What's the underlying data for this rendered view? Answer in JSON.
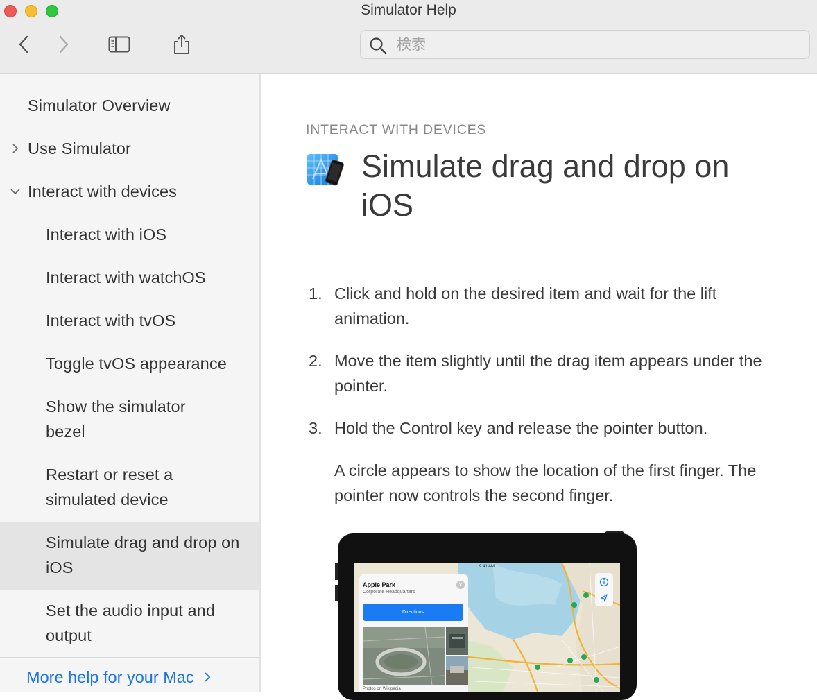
{
  "window": {
    "title": "Simulator Help"
  },
  "toolbar": {
    "search_placeholder": "検索"
  },
  "sidebar": {
    "items": [
      {
        "label": "Simulator Overview",
        "level": 0,
        "disclosure": ""
      },
      {
        "label": "Use Simulator",
        "level": 0,
        "disclosure": "collapsed"
      },
      {
        "label": "Interact with devices",
        "level": 0,
        "disclosure": "expanded"
      },
      {
        "label": "Interact with iOS",
        "level": 1
      },
      {
        "label": "Interact with watchOS",
        "level": 1
      },
      {
        "label": "Interact with tvOS",
        "level": 1
      },
      {
        "label": "Toggle tvOS appearance",
        "level": 1
      },
      {
        "label": "Show the simulator bezel",
        "level": 1
      },
      {
        "label": "Restart or reset a simulated device",
        "level": 1
      },
      {
        "label": "Simulate drag and drop on iOS",
        "level": 1,
        "selected": true
      },
      {
        "label": "Set the audio input and output",
        "level": 1
      }
    ],
    "more_help": "More help for your Mac"
  },
  "article": {
    "eyebrow": "INTERACT WITH DEVICES",
    "title": "Simulate drag and drop on iOS",
    "steps": [
      {
        "num": "1.",
        "text": "Click and hold on the desired item and wait for the lift animation."
      },
      {
        "num": "2.",
        "text": "Move the item slightly until the drag item appears under the pointer."
      },
      {
        "num": "3.",
        "text": "Hold the Control key and release the pointer button."
      }
    ],
    "note": "A circle appears to show the location of the first finger. The pointer now controls the second finger."
  },
  "figure": {
    "status_time": "9:41 AM",
    "card_title": "Apple Park",
    "card_subtitle": "Corporate Headquarters",
    "directions_label": "Directions",
    "photo_caption": "Photos on Wikipedia"
  },
  "colors": {
    "link": "#1a73e8",
    "selected_row": "#e4e4e4",
    "sidebar_bg": "#f5f5f5",
    "toolbar_bg": "#ebebeb"
  }
}
